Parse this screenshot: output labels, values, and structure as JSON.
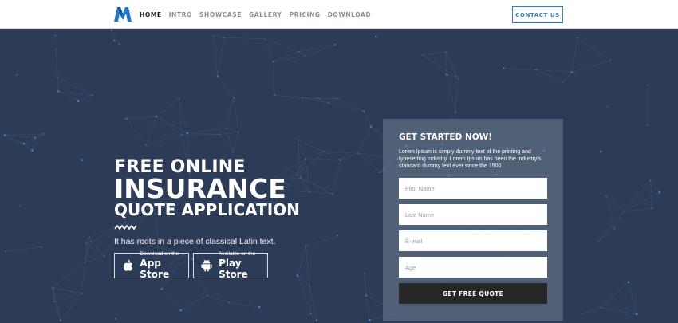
{
  "header": {
    "nav": [
      "HOME",
      "INTRO",
      "SHOWCASE",
      "GALLERY",
      "PRICING",
      "DOWNLOAD"
    ],
    "contact_label": "CONTACT US"
  },
  "hero": {
    "title_line1": "FREE ONLINE",
    "title_line2": "INSURANCE",
    "title_line3": "QUOTE APPLICATION",
    "tagline": "It has roots in a piece of classical Latin text.",
    "app_store": {
      "small": "Download on the",
      "big": "App Store",
      "icon": "apple-icon"
    },
    "play_store": {
      "small": "Available on the",
      "big": "Play Store",
      "icon": "android-icon"
    }
  },
  "form": {
    "title": "GET STARTED NOW!",
    "description": "Lorem Ipsum is simply dummy text of the printing and typesetting industry. Lorem Ipsum has been the industry's standard dummy text ever since the 1500",
    "fields": [
      {
        "placeholder": "First Name"
      },
      {
        "placeholder": "Last Name"
      },
      {
        "placeholder": "E-mail"
      },
      {
        "placeholder": "Age"
      }
    ],
    "submit_label": "GET FREE QUOTE"
  },
  "colors": {
    "hero_bg": "#2d3c56",
    "accent": "#2f7fc1",
    "button_dark": "#262626"
  }
}
